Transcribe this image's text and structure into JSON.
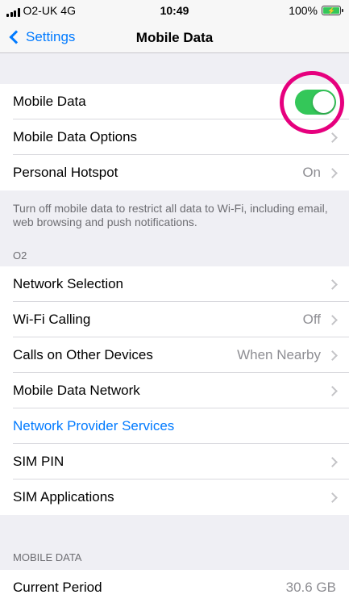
{
  "status_bar": {
    "carrier": "O2-UK",
    "network": "4G",
    "time": "10:49",
    "battery_percent": "100%"
  },
  "nav": {
    "back_label": "Settings",
    "title": "Mobile Data"
  },
  "group1": {
    "mobile_data": {
      "label": "Mobile Data",
      "toggle_on": true
    },
    "mobile_data_options": {
      "label": "Mobile Data Options"
    },
    "personal_hotspot": {
      "label": "Personal Hotspot",
      "value": "On"
    }
  },
  "footer_note": "Turn off mobile data to restrict all data to Wi-Fi, including email, web browsing and push notifications.",
  "section_o2": "O2",
  "group2": [
    {
      "label": "Network Selection",
      "value": "",
      "link": false
    },
    {
      "label": "Wi-Fi Calling",
      "value": "Off",
      "link": false
    },
    {
      "label": "Calls on Other Devices",
      "value": "When Nearby",
      "link": false
    },
    {
      "label": "Mobile Data Network",
      "value": "",
      "link": false
    },
    {
      "label": "Network Provider Services",
      "value": "",
      "link": true
    },
    {
      "label": "SIM PIN",
      "value": "",
      "link": false
    },
    {
      "label": "SIM Applications",
      "value": "",
      "link": false
    }
  ],
  "section_mobile_data": "MOBILE DATA",
  "group3": {
    "current_period": {
      "label": "Current Period",
      "value": "30.6 GB"
    }
  },
  "colors": {
    "accent": "#007aff",
    "toggle_on": "#34c759",
    "highlight": "#e6007e"
  }
}
